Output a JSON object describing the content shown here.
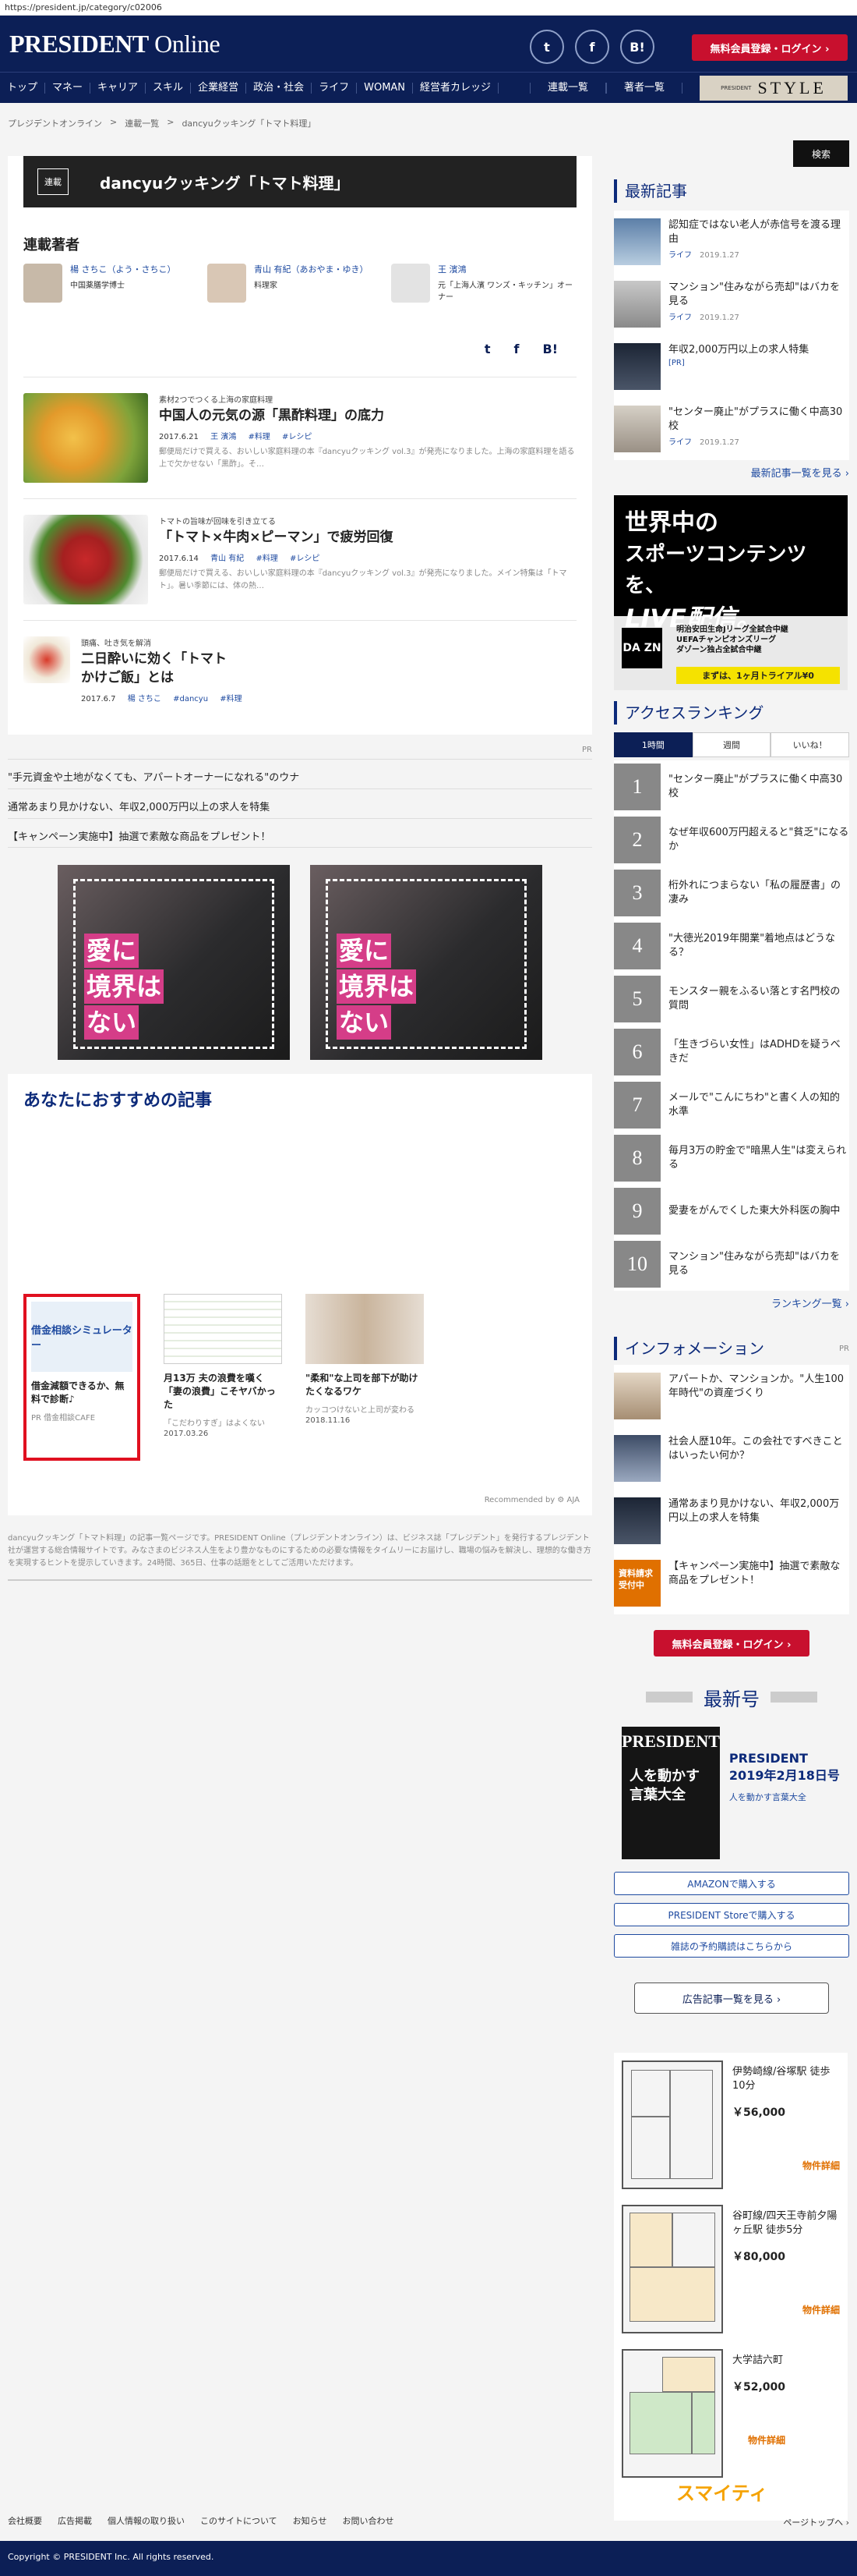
{
  "url": "https://president.jp/category/c02006",
  "header": {
    "logo_main": "PRESIDENT",
    "logo_sub": " Online",
    "social": [
      "t",
      "f",
      "B!"
    ],
    "register_label": "無料会員登録・ログイン ›"
  },
  "nav": {
    "items": [
      "トップ",
      "マネー",
      "キャリア",
      "スキル",
      "企業経営",
      "政治・社会",
      "ライフ",
      "WOMAN",
      "経営者カレッジ"
    ],
    "right_items": [
      "連載一覧",
      "著者一覧"
    ],
    "style_small": "PRESIDENT",
    "style_big": "STYLE"
  },
  "breadcrumb": [
    "プレジデントオンライン",
    ">",
    "連載一覧",
    ">",
    "dancyuクッキング「トマト料理」"
  ],
  "category": {
    "badge": "連載",
    "title": "dancyuクッキング「トマト料理」"
  },
  "authors": {
    "title": "連載著者",
    "list": [
      {
        "name": "楊 さちこ（よう・さちこ）",
        "role": "中国薬膳学博士"
      },
      {
        "name": "青山 有紀（あおやま・ゆき）",
        "role": "料理家"
      },
      {
        "name": "王 濱鴻",
        "role": "元「上海人濱 ワンズ・キッチン」オーナー"
      }
    ]
  },
  "share": [
    "t",
    "f",
    "B!"
  ],
  "articles": [
    {
      "sub": "素材2つでつくる上海の家庭料理",
      "title": "中国人の元気の源「黒酢料理」の底力",
      "date": "2017.6.21",
      "author": "王 濱鴻",
      "tags": [
        "#料理",
        "#レシピ"
      ],
      "excerpt": "郵便局だけで買える、おいしい家庭料理の本『dancyuクッキング vol.3』が発売になりました。上海の家庭料理を語る上で欠かせない「黒酢」。そ…"
    },
    {
      "sub": "トマトの旨味が回味を引き立てる",
      "title": "「トマト×牛肉×ピーマン」で疲労回復",
      "date": "2017.6.14",
      "author": "青山 有紀",
      "tags": [
        "#料理",
        "#レシピ"
      ],
      "excerpt": "郵便局だけで買える、おいしい家庭料理の本『dancyuクッキング vol.3』が発売になりました。メイン特集は「トマト」。暑い季節には、体の熱…"
    },
    {
      "sub": "頭痛、吐き気を解消",
      "title": "二日酔いに効く「トマトかけご飯」とは",
      "date": "2017.6.7",
      "author": "楊 さちこ",
      "tags": [
        "#dancyu",
        "#料理"
      ],
      "excerpt": ""
    }
  ],
  "pr_label": "PR",
  "text_ads": [
    "\"手元資金や土地がなくても、アパートオーナーになれる\"のウナ",
    "通常あまり見かけない、年収2,000万円以上の求人を特集",
    "【キャンペーン実施中】抽選で素敵な商品をプレゼント！"
  ],
  "banner": {
    "line1": "愛に",
    "line2": "境界は",
    "line3": "ない"
  },
  "recommend": {
    "title": "あなたにおすすめの記事",
    "items": [
      {
        "img_text": "借金相談シミュレーター",
        "title": "借金減額できるか、無料で診断♪",
        "source": "PR 借金相談CAFE",
        "date": ""
      },
      {
        "img_text": "",
        "title": "月13万 夫の浪費を嘆く「妻の浪費」こそヤバかった",
        "source": "「こだわりすぎ」はよくない",
        "date": "2017.03.26"
      },
      {
        "img_text": "",
        "title": "\"柔和\"な上司を部下が助けたくなるワケ",
        "source": "カッコつけないと上司が変わる",
        "date": "2018.11.16"
      }
    ],
    "powered": "Recommended by ⚙ AJA"
  },
  "description": "dancyuクッキング「トマト料理」の記事一覧ページです。PRESIDENT Online（プレジデントオンライン）は、ビジネス誌「プレジデント」を発行するプレジデント社が運営する総合情報サイトです。みなさまのビジネス人生をより豊かなものにするための必要な情報をタイムリーにお届けし、職場の悩みを解決し、理想的な働き方を実現するヒントを提示していきます。24時間、365日、仕事の話題をとしてご活用いただけます。",
  "sidebar": {
    "search_label": "検索",
    "latest_title": "最新記事",
    "latest": [
      {
        "title": "認知症ではない老人が赤信号を渡る理由",
        "cat": "ライフ",
        "date": "2019.1.27"
      },
      {
        "title": "マンション\"住みながら売却\"はバカを見る",
        "cat": "ライフ",
        "date": "2019.1.27"
      },
      {
        "title": "年収2,000万円以上の求人特集",
        "cat": "[PR]",
        "date": ""
      },
      {
        "title": "\"センター廃止\"がプラスに働く中高30校",
        "cat": "ライフ",
        "date": "2019.1.27"
      }
    ],
    "latest_more": "最新記事一覧を見る ›",
    "dazn": {
      "l1": "世界中の",
      "l2": "スポーツコンテンツを、",
      "l3": "LIVE配信。",
      "logo": "DA ZN",
      "info1": "明治安田生命Jリーグ全試合中継",
      "info2": "UEFAチャンピオンズリーグ",
      "info3": "ダゾーン独占全試合中継",
      "cta": "まずは、1ヶ月トライアル¥0"
    },
    "ranking_title": "アクセスランキング",
    "ranking_tabs": [
      "1時間",
      "週間",
      "いいね！"
    ],
    "ranking": [
      "\"センター廃止\"がプラスに働く中高30校",
      "なぜ年収600万円超えると\"貧乏\"になるか",
      "桁外れにつまらない「私の履歴書」の凄み",
      "\"大徳光2019年開業\"着地点はどうなる？",
      "モンスター親をふるい落とす名門校の質問",
      "「生きづらい女性」はADHDを疑うべきだ",
      "メールで\"こんにちわ\"と書く人の知的水準",
      "毎月3万の貯金で\"暗黒人生\"は変えられる",
      "愛妻をがんでくした東大外科医の胸中",
      "マンション\"住みながら売却\"はバカを見る"
    ],
    "ranking_more": "ランキング一覧 ›",
    "info_title": "インフォメーション",
    "info_pr": "PR",
    "info": [
      "アパートか、マンションか。\"人生100年時代\"の資産づくり",
      "社会人歴10年。この会社ですべきことはいったい何か？",
      "通常あまり見かけない、年収2,000万円以上の求人を特集",
      "【キャンペーン実施中】抽選で素敵な商品をプレゼント！"
    ],
    "info_badge": "資料請求受付中",
    "register_label": "無料会員登録・ログイン ›",
    "latest_issue_title": "最新号",
    "magazine": {
      "cover_title": "PRESIDENT",
      "cover_text": "人を動かす言葉大全",
      "title": "PRESIDENT 2019年2月18日号",
      "subtitle": "人を動かす言葉大全"
    },
    "buy_buttons": [
      "AMAZONで購入する",
      "PRESIDENT Storeで購入する",
      "雑誌の予約購読はこちらから"
    ],
    "ad_list_label": "広告記事一覧を見る ›",
    "properties": [
      {
        "name": "伊勢崎線/谷塚駅 徒歩10分",
        "price": "￥56,000",
        "link": "物件詳細"
      },
      {
        "name": "谷町線/四天王寺前夕陽ヶ丘駅 徒歩5分",
        "price": "￥80,000",
        "link": "物件詳細"
      },
      {
        "name": "大学詰六町",
        "price": "￥52,000",
        "link": "物件詳細"
      }
    ],
    "smaity": "スマイティ"
  },
  "footer": {
    "links": [
      "会社概要",
      "広告掲載",
      "個人情報の取り扱い",
      "このサイトについて",
      "お知らせ",
      "お問い合わせ"
    ],
    "page_top": "ページトップへ ›",
    "copyright": "Copyright © PRESIDENT Inc. All rights reserved."
  }
}
